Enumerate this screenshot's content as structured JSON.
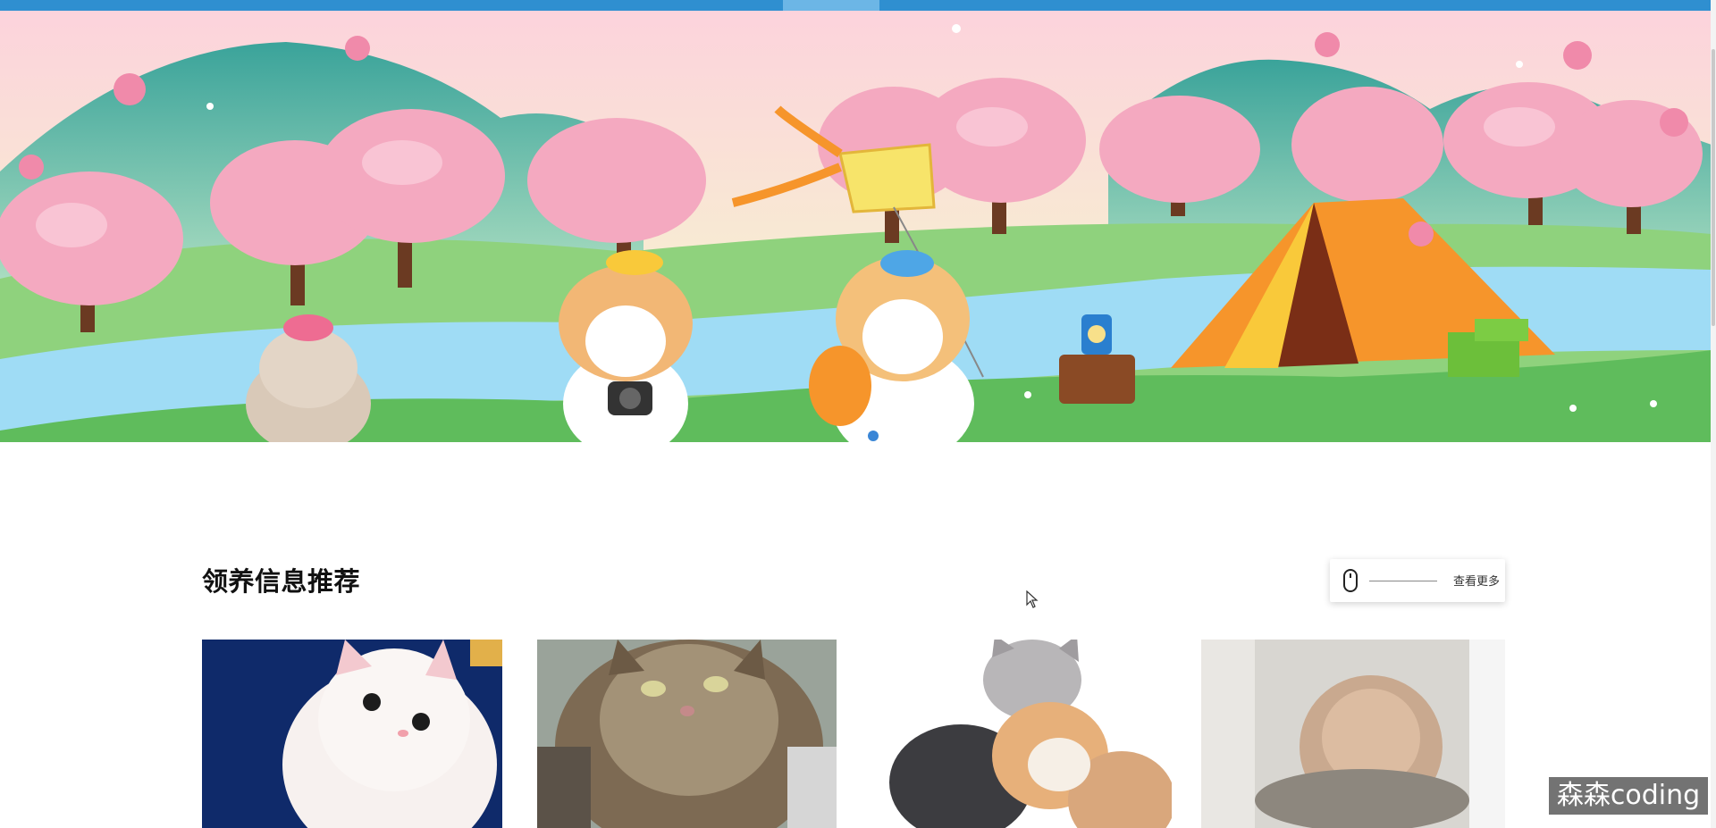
{
  "banner": {
    "alt": "cartoon pets camping under cherry blossom trees"
  },
  "section": {
    "title": "领养信息推荐",
    "more_label": "查看更多"
  },
  "pets": [
    {
      "name": "white-kitten"
    },
    {
      "name": "tabby-cat"
    },
    {
      "name": "cat-trio"
    },
    {
      "name": "blurred-kitten"
    }
  ],
  "watermark": "森森coding",
  "colors": {
    "nav_blue": "#2f8fd0",
    "sky_pink": "#fbd6dc",
    "blossom_pink": "#f4a9c0",
    "grass_green": "#6cc26a",
    "river_blue": "#9fdcf5",
    "tent_orange": "#f6952b",
    "title_text": "#111111"
  }
}
